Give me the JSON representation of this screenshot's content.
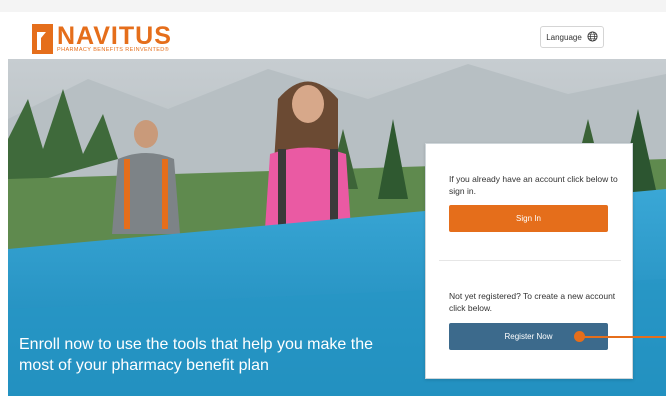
{
  "browser": {
    "url_fragment": ""
  },
  "header": {
    "brand": "NAVITUS",
    "tagline": "PHARMACY BENEFITS REINVENTED®",
    "language_label": "Language"
  },
  "hero": {
    "headline": "Enroll now to use the tools that help you make the most of your pharmacy benefit plan"
  },
  "card": {
    "signin_prompt": "If you already have an account click below to sign in.",
    "signin_label": "Sign In",
    "register_prompt": "Not yet registered? To create a new account click below.",
    "register_label": "Register Now"
  },
  "colors": {
    "brand_orange": "#e56e1b",
    "register_blue": "#3c6a8c",
    "hero_blue": "#2796c4"
  },
  "icons": {
    "language": "globe-icon"
  }
}
